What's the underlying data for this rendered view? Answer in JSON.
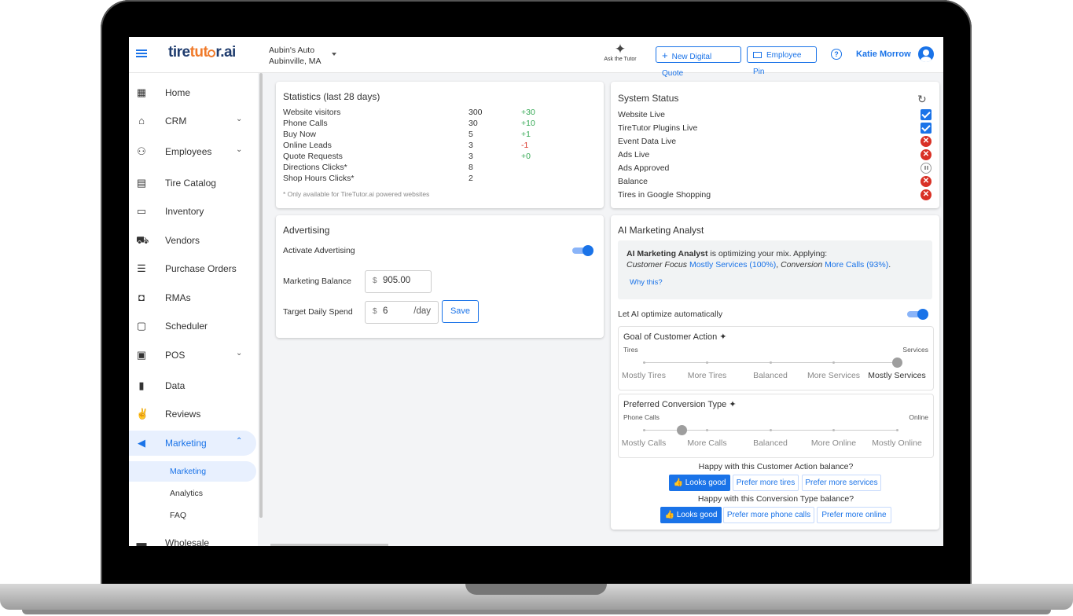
{
  "app": {
    "logo_part1": "tire",
    "logo_part2": "tut",
    "logo_part3": "r",
    "logo_part4": ".ai"
  },
  "shop": {
    "name": "Aubin's Auto",
    "location": "Aubinville, MA"
  },
  "header": {
    "ask_label": "Ask the Tutor",
    "new_quote_label": "New Digital Quote",
    "employee_pin_label": "Employee Pin",
    "user_name": "Katie Morrow"
  },
  "sidebar": {
    "items": [
      {
        "label": "Home",
        "icon": "dashboard-icon"
      },
      {
        "label": "CRM",
        "icon": "store-icon"
      },
      {
        "label": "Employees",
        "icon": "people-icon"
      },
      {
        "label": "Tire Catalog",
        "icon": "catalog-icon"
      },
      {
        "label": "Inventory",
        "icon": "archive-icon"
      },
      {
        "label": "Vendors",
        "icon": "truck-icon"
      },
      {
        "label": "Purchase Orders",
        "icon": "list-icon"
      },
      {
        "label": "RMAs",
        "icon": "return-icon"
      },
      {
        "label": "Scheduler",
        "icon": "calendar-icon"
      },
      {
        "label": "POS",
        "icon": "register-icon"
      },
      {
        "label": "Data",
        "icon": "bar-chart-icon"
      },
      {
        "label": "Reviews",
        "icon": "thumbs-icon"
      },
      {
        "label": "Marketing",
        "icon": "megaphone-icon"
      },
      {
        "label": "Wholesale",
        "icon": "wholesale-icon"
      }
    ],
    "sub_items": [
      "Marketing",
      "Analytics",
      "FAQ"
    ]
  },
  "stats": {
    "title": "Statistics (last 28 days)",
    "rows": [
      {
        "label": "Website visitors",
        "value": "300",
        "delta": "+30"
      },
      {
        "label": "Phone Calls",
        "value": "30",
        "delta": "+10"
      },
      {
        "label": "Buy Now",
        "value": "5",
        "delta": "+1"
      },
      {
        "label": "Online Leads",
        "value": "3",
        "delta": "-1"
      },
      {
        "label": "Quote Requests",
        "value": "3",
        "delta": "+0"
      },
      {
        "label": "Directions Clicks*",
        "value": "8",
        "delta": ""
      },
      {
        "label": "Shop Hours Clicks*",
        "value": "2",
        "delta": ""
      }
    ],
    "footnote": "* Only available for TireTutor.ai powered websites"
  },
  "advertising": {
    "title": "Advertising",
    "activate_label": "Activate Advertising",
    "balance_label": "Marketing Balance",
    "balance_prefix": "$",
    "balance_value": "905.00",
    "spend_label": "Target Daily Spend",
    "spend_prefix": "$",
    "spend_value": "6",
    "spend_suffix": "/day",
    "save_label": "Save"
  },
  "system_status": {
    "title": "System Status",
    "rows": [
      {
        "label": "Website Live",
        "status": "check"
      },
      {
        "label": "TireTutor Plugins Live",
        "status": "check"
      },
      {
        "label": "Event Data Live",
        "status": "error"
      },
      {
        "label": "Ads Live",
        "status": "error"
      },
      {
        "label": "Ads Approved",
        "status": "paused"
      },
      {
        "label": "Balance",
        "status": "error"
      },
      {
        "label": "Tires in Google Shopping",
        "status": "error"
      }
    ]
  },
  "ai_analyst": {
    "title": "AI Marketing Analyst",
    "line1_strong": "AI Marketing Analyst",
    "line1_rest": " is optimizing your mix. Applying:",
    "focus_label": "Customer Focus",
    "focus_value": "Mostly Services (100%)",
    "conversion_label": "Conversion",
    "conversion_value": "More Calls (93%)",
    "why_label": "Why this?",
    "auto_label": "Let AI optimize automatically",
    "goal": {
      "title": "Goal of Customer Action",
      "left_end": "Tires",
      "right_end": "Services",
      "options": [
        "Mostly Tires",
        "More Tires",
        "Balanced",
        "More Services",
        "Mostly Services"
      ],
      "selected_index": 4
    },
    "conversion_type": {
      "title": "Preferred Conversion Type",
      "left_end": "Phone Calls",
      "right_end": "Online",
      "options": [
        "Mostly Calls",
        "More Calls",
        "Balanced",
        "More Online",
        "Mostly Online"
      ],
      "selected_index": 0.6
    },
    "q1": "Happy with this Customer Action balance?",
    "q1_buttons": [
      "👍 Looks good",
      "Prefer more tires",
      "Prefer more services"
    ],
    "q2": "Happy with this Conversion Type balance?",
    "q2_buttons": [
      "👍 Looks good",
      "Prefer more phone calls",
      "Prefer more online"
    ]
  },
  "colors": {
    "accent": "#1a73e8",
    "error": "#d93025",
    "success": "#34a853",
    "logo_orange": "#f07a2a"
  }
}
